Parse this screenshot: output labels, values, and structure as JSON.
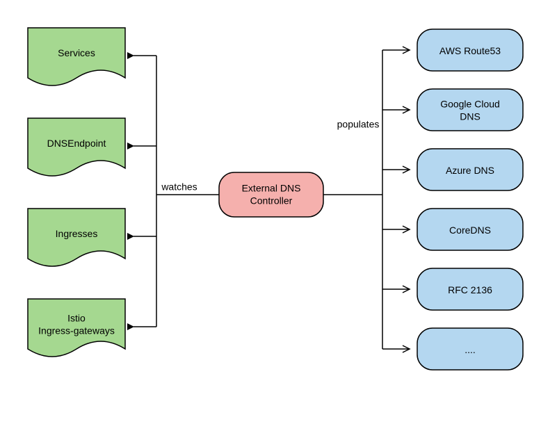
{
  "controller": {
    "label": "External DNS Controller"
  },
  "edges": {
    "watches_label": "watches",
    "populates_label": "populates"
  },
  "sources": [
    {
      "label": "Services"
    },
    {
      "label": "DNSEndpoint"
    },
    {
      "label": "Ingresses"
    },
    {
      "label": "Istio Ingress-gateways"
    }
  ],
  "providers": [
    {
      "label": "AWS Route53"
    },
    {
      "label": "Google Cloud DNS"
    },
    {
      "label": "Azure DNS"
    },
    {
      "label": "CoreDNS"
    },
    {
      "label": "RFC 2136"
    },
    {
      "label": "...."
    }
  ]
}
